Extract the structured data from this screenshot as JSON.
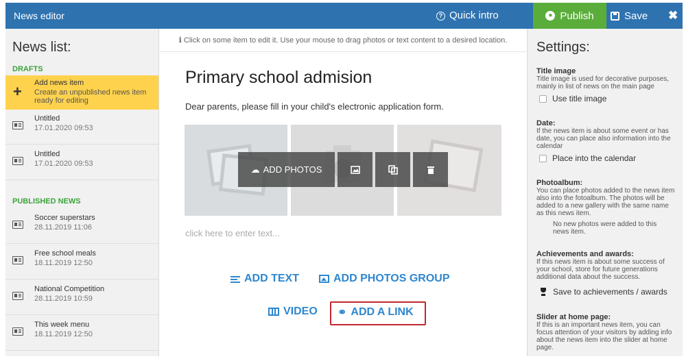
{
  "header": {
    "title": "News editor",
    "quick_intro": "Quick intro",
    "publish": "Publish",
    "save": "Save",
    "close": "✖"
  },
  "news_list": {
    "title": "News list:",
    "drafts_label": "DRAFTS",
    "add_item": {
      "title": "Add news item",
      "desc": "Create an unpublished news item ready for editing"
    },
    "drafts": [
      {
        "title": "Untitled",
        "date": "17.01.2020 09:53"
      },
      {
        "title": "Untitled",
        "date": "17.01.2020 09:53"
      }
    ],
    "published_label": "PUBLISHED NEWS",
    "published": [
      {
        "title": "Soccer superstars",
        "date": "28.11.2019 11:06"
      },
      {
        "title": "Free school meals",
        "date": "18.11.2019 12:50"
      },
      {
        "title": "National Competition",
        "date": "28.11.2019 10:59"
      },
      {
        "title": "This week menu",
        "date": "18.11.2019 12:50"
      }
    ]
  },
  "editor": {
    "hint": "Click on some item to edit it. Use your mouse to drag photos or text content to a desired location.",
    "article_title": "Primary school admision",
    "article_text": "Dear parents, please fill in your child's electronic application form.",
    "add_photos": "ADD PHOTOS",
    "placeholder": "click here to enter text...",
    "add_text": "ADD TEXT",
    "add_photos_group": "ADD PHOTOS GROUP",
    "video": "VIDEO",
    "add_link": "ADD A LINK"
  },
  "settings": {
    "title": "Settings:",
    "title_image": {
      "heading": "Title image",
      "desc": "Title image is used for decorative purposes, mainly in list of news on the main page",
      "checkbox": "Use title image"
    },
    "date": {
      "heading": "Date:",
      "desc": "If the news item is about some event or has date, you can place also information into the calendar",
      "checkbox": "Place into the calendar"
    },
    "photoalbum": {
      "heading": "Photoalbum:",
      "desc": "You can place photos added to the news item also into the fotoalbum. The photos will be added to a new gallery with the same name as this news item.",
      "note": "No new photos were added to this news item."
    },
    "achievements": {
      "heading": "Achievements and awards:",
      "desc": "If this news item is about some success of your school, store for future generations additional data about the success.",
      "action": "Save to achievements / awards"
    },
    "slider": {
      "heading": "Slider at home page:",
      "desc": "If this is an important news item, you can focus attention of your visitors by adding info about the news item into the slider at home page."
    }
  },
  "colors": {
    "header_blue": "#2e73b0",
    "publish_green": "#5aad3a",
    "highlight_yellow": "#ffd24d",
    "link_blue": "#2e87cf",
    "section_green": "#3ba33b",
    "outline_red": "#c1272d"
  }
}
